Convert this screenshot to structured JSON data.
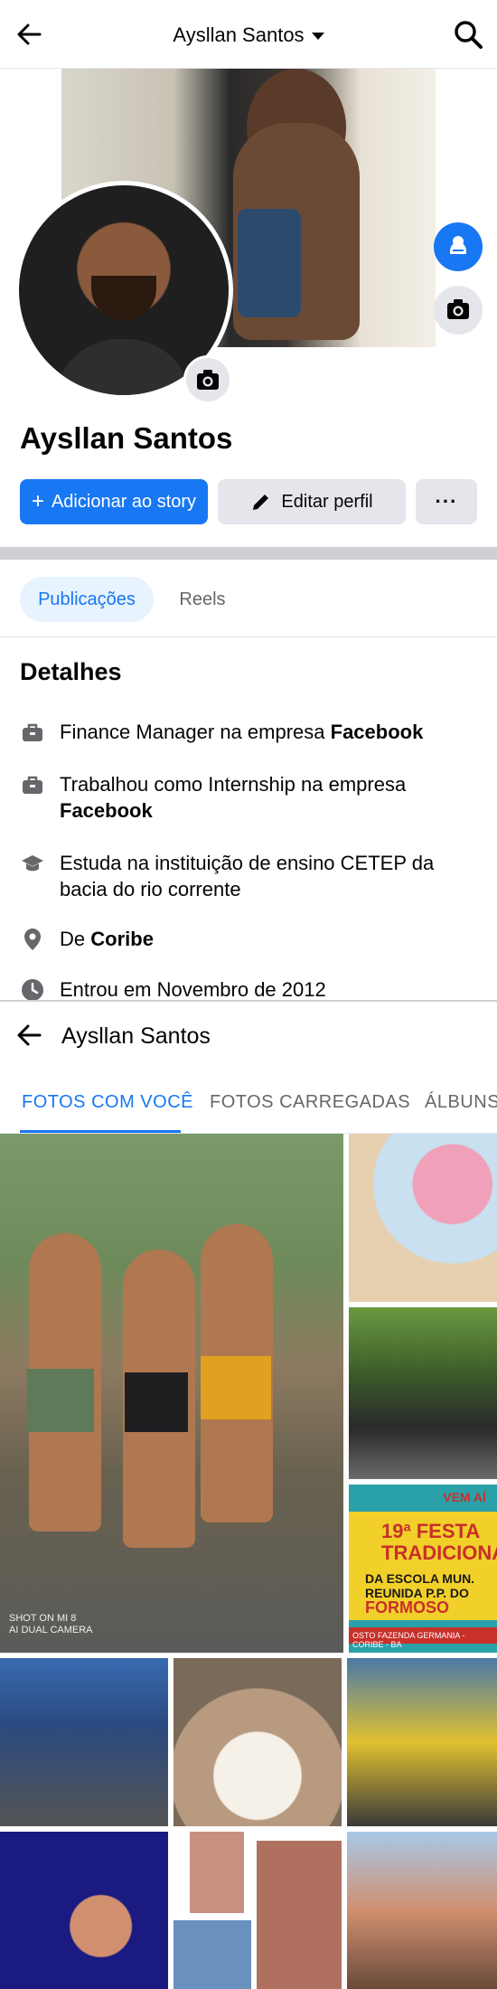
{
  "topbar": {
    "title": "Aysllan Santos",
    "icons": {
      "back": "arrow-left-icon",
      "dropdown": "caret-down-icon",
      "search": "search-icon"
    }
  },
  "profile": {
    "name": "Aysllan Santos",
    "buttons": {
      "add_story": "Adicionar ao story",
      "edit_profile": "Editar perfil",
      "more": "···"
    }
  },
  "tabs": [
    "Publicações",
    "Reels"
  ],
  "details": {
    "title": "Detalhes",
    "items": [
      {
        "icon": "briefcase-icon",
        "text_before": "Finance Manager na empresa ",
        "bold": "Facebook",
        "text_after": ""
      },
      {
        "icon": "briefcase-icon",
        "text_before": "Trabalhou como Internship na empresa ",
        "bold": "Facebook",
        "text_after": ""
      },
      {
        "icon": "graduation-cap-icon",
        "text_before": "Estuda na instituição de ensino CETEP da bacia do rio corrente",
        "bold": "",
        "text_after": ""
      },
      {
        "icon": "location-pin-icon",
        "text_before": "De ",
        "bold": "Coribe",
        "text_after": ""
      },
      {
        "icon": "clock-icon",
        "text_before": "Entrou em Novembro de 2012",
        "bold": "",
        "text_after": ""
      }
    ]
  },
  "photos_page": {
    "title": "Aysllan Santos",
    "tabs": [
      "FOTOS COM VOCÊ",
      "FOTOS CARREGADAS",
      "ÁLBUNS"
    ],
    "active_tab": "FOTOS COM VOCÊ",
    "watermark": [
      "SHOT ON MI 8",
      "AI DUAL CAMERA"
    ],
    "poster": {
      "vem": "VEM AÍ",
      "line1": "19ª FESTA",
      "line2": "TRADICIONAL",
      "line3": "DA ESCOLA MUN.",
      "line4": "REUNIDA P.P. DO",
      "line5": "FORMOSO",
      "footer": "OSTO FAZENDA GERMANIA - CORIBE - BA"
    }
  },
  "colors": {
    "accent": "#1877f2",
    "button_gray": "#e4e6eb",
    "tab_bg": "#e7f3ff",
    "secondary_text": "#65676b"
  }
}
